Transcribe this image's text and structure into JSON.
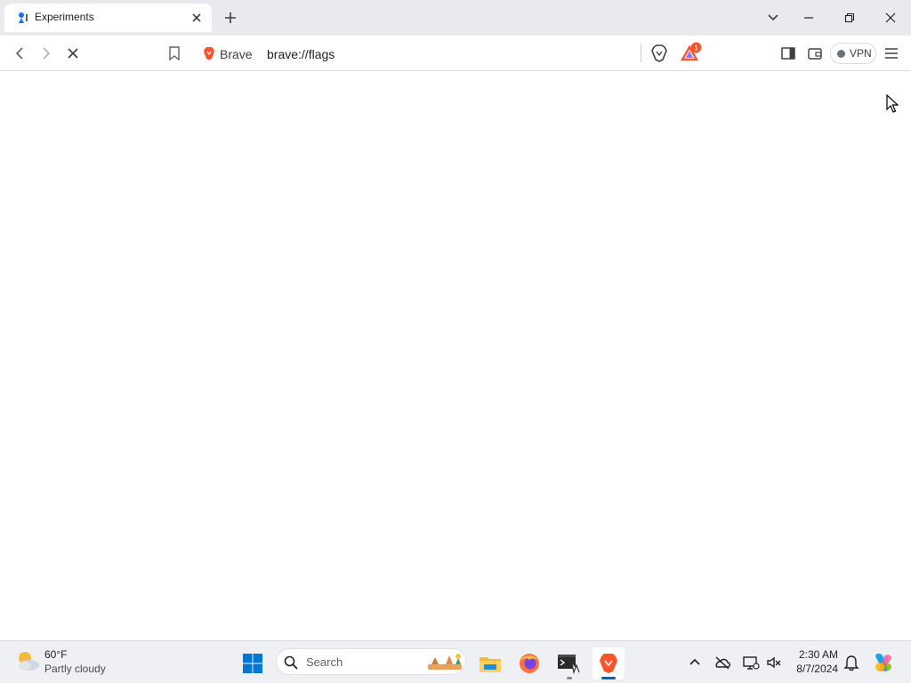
{
  "tab": {
    "title": "Experiments"
  },
  "omnibox": {
    "site_label": "Brave",
    "url": "brave://flags"
  },
  "toolbar": {
    "vpn_label": "VPN",
    "rewards_badge": "1"
  },
  "taskbar": {
    "weather_temp": "60°F",
    "weather_desc": "Partly cloudy",
    "search_label": "Search",
    "time": "2:30 AM",
    "date": "8/7/2024"
  },
  "colors": {
    "tabstrip_bg": "#e8eaed",
    "brave_orange": "#fb542b",
    "windows_blue": "#0067c0",
    "taskbar_bg": "#eef0f4"
  }
}
